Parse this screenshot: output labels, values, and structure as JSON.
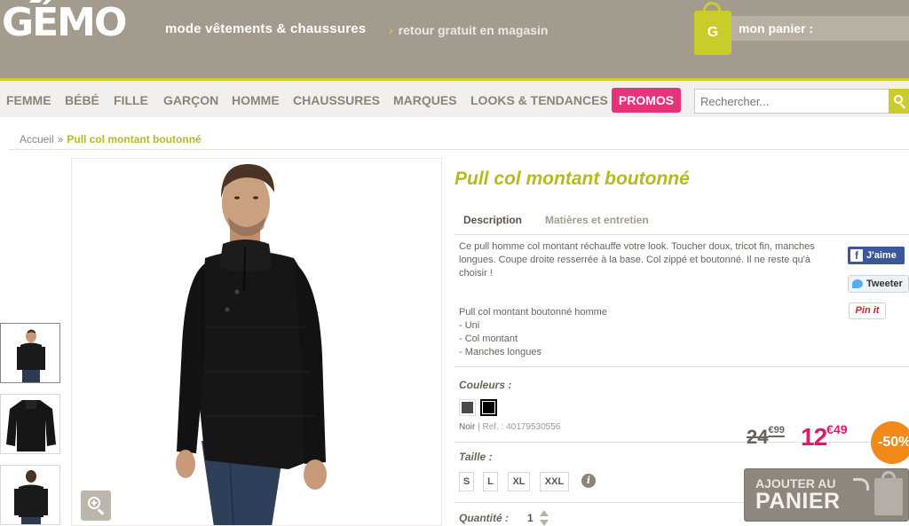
{
  "header": {
    "logo": "GÉMO",
    "tagline": "mode vêtements & chaussures",
    "tagline2": "retour gratuit en magasin",
    "basket_label": "mon panier :",
    "basket_bag_letter": "G"
  },
  "nav": {
    "items": [
      "FEMME",
      "BÉBÉ",
      "FILLE",
      "GARÇON",
      "HOMME",
      "CHAUSSURES",
      "MARQUES",
      "LOOKS & TENDANCES"
    ],
    "promos": "PROMOS",
    "search_placeholder": "Rechercher..."
  },
  "breadcrumb": {
    "home": "Accueil",
    "separator": "»",
    "current": "Pull col montant boutonné"
  },
  "product": {
    "title": "Pull col montant boutonné",
    "tabs": [
      "Description",
      "Matières et entretien"
    ],
    "description": "Ce pull homme col montant réchauffe votre look. Toucher doux, tricot fin, manches longues. Coupe droite resserrée à la base. Col zippé et boutonné. Il ne reste qu'à choisir !",
    "features_title": "Pull col montant boutonné homme",
    "features": [
      "- Uni",
      "- Col montant",
      "- Manches longues"
    ],
    "colors_label": "Couleurs :",
    "colors": [
      {
        "name": "Gris foncé",
        "hex": "#4a4a4a"
      },
      {
        "name": "Noir",
        "hex": "#000000"
      }
    ],
    "selected_color": "Noir",
    "ref_sep": "|",
    "ref_label": "Ref. : 40179530556",
    "size_label": "Taille :",
    "sizes": [
      "S",
      "L",
      "XL",
      "XXL"
    ],
    "info_icon": "i",
    "quantity_label": "Quantité :",
    "quantity": "1",
    "old_price_main": "24",
    "old_price_cents": "€99",
    "new_price_main": "12",
    "new_price_cents": "€49",
    "discount": "-50%",
    "add_to_cart_line1": "AJOUTER AU",
    "add_to_cart_line2": "PANIER"
  },
  "social": {
    "facebook": "J'aime",
    "facebook_glyph": "f",
    "twitter": "Tweeter",
    "pinterest": "Pin it"
  },
  "colors": {
    "accent": "#c9cc2a",
    "header_bg": "#a49b8f",
    "promo": "#e5337c",
    "price": "#e0196c",
    "discount": "#f28a1a"
  }
}
